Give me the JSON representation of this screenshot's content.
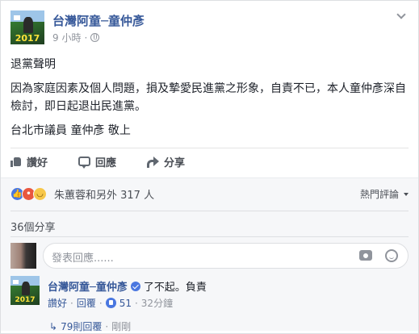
{
  "post": {
    "author": "台灣阿童─童仲彥",
    "avatar_year": "2017",
    "time": "9 小時",
    "time_sep": "·",
    "paragraphs": [
      "退黨聲明",
      "因為家庭因素及個人問題，損及摯愛民進黨之形象，自責不已，本人童仲彥深自檢討，即日起退出民進黨。",
      "台北市議員 童仲彥 敬上"
    ]
  },
  "actions": {
    "like": "讚好",
    "comment": "回應",
    "share": "分享"
  },
  "feedback": {
    "reaction_icons": [
      "like-icon",
      "angry-icon",
      "haha-icon"
    ],
    "reaction_summary": "朱蕙蓉和另外 317 人",
    "sort_label": "熱門評論",
    "shares_count": "36個分享",
    "comment_placeholder": "發表回應......"
  },
  "reply": {
    "author": "台灣阿童─童仲彥",
    "avatar_year": "2017",
    "text": "了不起。負責",
    "like_label": "讚好",
    "reply_label": "回覆",
    "like_count": "51",
    "time": "32分鐘",
    "sep": "·"
  },
  "more_replies": {
    "label": "79則回覆",
    "sep": "·",
    "time": "剛剛"
  },
  "colors": {
    "link": "#365899",
    "reaction_blue": "#4a77e0",
    "muted": "#90949c"
  }
}
